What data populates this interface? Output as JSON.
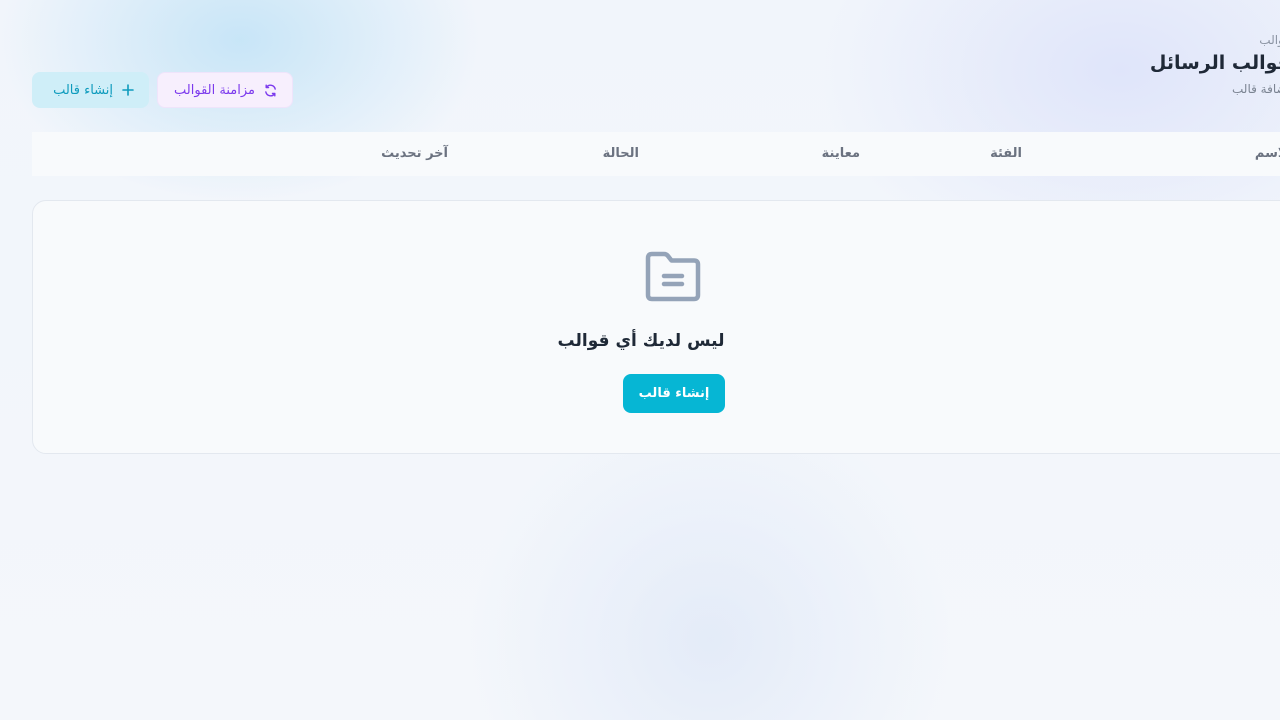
{
  "header": {
    "breadcrumb": "قوالب",
    "title": "قوالب الرسائل",
    "subtitle": "إضافة قالب"
  },
  "actions": {
    "create_label": "إنشاء قالب",
    "sync_label": "مزامنة القوالب"
  },
  "table": {
    "columns": [
      "الاسم",
      "الفئة",
      "معاينة",
      "الحالة",
      "آخر تحديث"
    ]
  },
  "empty_state": {
    "icon": "folder-icon",
    "message": "ليس لديك أي قوالب",
    "button_label": "إنشاء قالب"
  },
  "colors": {
    "accent": "#06b6d4",
    "sync": "#7c3aed"
  }
}
